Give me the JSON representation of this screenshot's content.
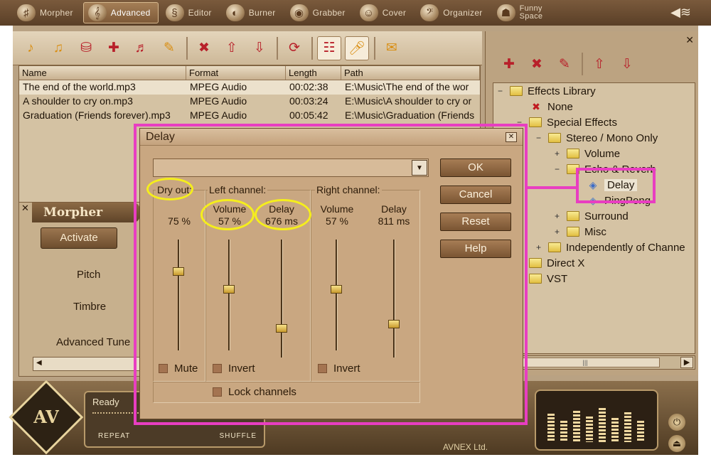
{
  "nav": {
    "tabs": [
      {
        "label": "Morpher",
        "icon": "morpher-icon"
      },
      {
        "label": "Advanced",
        "icon": "advanced-icon",
        "active": true
      },
      {
        "label": "Editor",
        "icon": "editor-icon"
      },
      {
        "label": "Burner",
        "icon": "burner-icon"
      },
      {
        "label": "Grabber",
        "icon": "grabber-icon"
      },
      {
        "label": "Cover",
        "icon": "cover-icon"
      },
      {
        "label": "Organizer",
        "icon": "organizer-icon"
      },
      {
        "label": "Funny\nSpace",
        "icon": "funny-space-icon"
      }
    ]
  },
  "file_list": {
    "columns": [
      "Name",
      "Format",
      "Length",
      "Path"
    ],
    "rows": [
      {
        "name": "The end of the world.mp3",
        "format": "MPEG Audio",
        "length": "00:02:38",
        "path": "E:\\Music\\The end of the wor"
      },
      {
        "name": "A shoulder to cry on.mp3",
        "format": "MPEG Audio",
        "length": "00:03:24",
        "path": "E:\\Music\\A shoulder to cry or"
      },
      {
        "name": "Graduation (Friends forever).mp3",
        "format": "MPEG Audio",
        "length": "00:05:42",
        "path": "E:\\Music\\Graduation (Friends"
      }
    ]
  },
  "morpher": {
    "title": "Morpher",
    "activate_label": "Activate",
    "pitch_label": "Pitch",
    "timbre_label": "Timbre",
    "advanced_label": "Advanced Tune"
  },
  "effects_tree": {
    "nodes": [
      {
        "label": "Effects Library"
      },
      {
        "label": "None"
      },
      {
        "label": "Special Effects"
      },
      {
        "label": "Stereo / Mono Only"
      },
      {
        "label": "Volume"
      },
      {
        "label": "Echo & Reverb"
      },
      {
        "label": "Delay"
      },
      {
        "label": "PingPong"
      },
      {
        "label": "Surround"
      },
      {
        "label": "Misc"
      },
      {
        "label": "Independently of Channe"
      },
      {
        "label": "Direct X"
      },
      {
        "label": "VST"
      }
    ]
  },
  "player": {
    "status": "Ready",
    "repeat_label": "REPEAT",
    "shuffle_label": "SHUFFLE",
    "brand": "AVNEX Ltd.",
    "logo_text": "AV"
  },
  "delay_dialog": {
    "title": "Delay",
    "preset_value": "",
    "dry_out": {
      "label": "Dry out:",
      "value": "75 %",
      "level": 0.75,
      "mute_label": "Mute"
    },
    "left_channel": {
      "label": "Left channel:",
      "volume_label": "Volume",
      "volume_value": "57 %",
      "volume_level": 0.57,
      "delay_label": "Delay",
      "delay_value": "676 ms",
      "delay_level": 0.18,
      "invert_label": "Invert"
    },
    "right_channel": {
      "label": "Right channel:",
      "volume_label": "Volume",
      "volume_value": "57 %",
      "volume_level": 0.57,
      "delay_label": "Delay",
      "delay_value": "811 ms",
      "delay_level": 0.22,
      "invert_label": "Invert"
    },
    "lock_label": "Lock channels",
    "buttons": {
      "ok": "OK",
      "cancel": "Cancel",
      "reset": "Reset",
      "help": "Help"
    }
  },
  "colors": {
    "highlight_circle": "#f5ee1c",
    "highlight_box": "#e83ec1"
  }
}
